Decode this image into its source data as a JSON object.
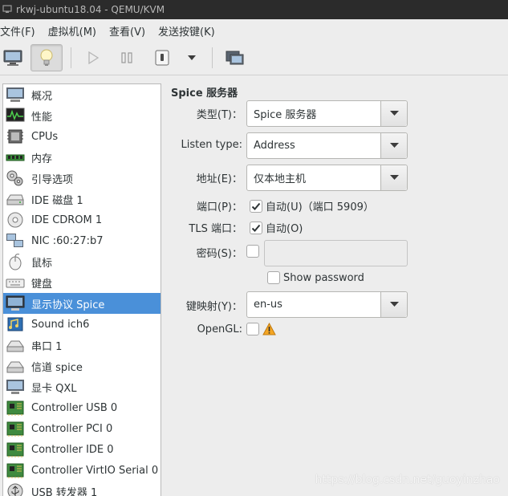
{
  "window": {
    "title": "rkwj-ubuntu18.04 - QEMU/KVM"
  },
  "menubar": {
    "items": [
      {
        "label": "文件(F)"
      },
      {
        "label": "虚拟机(M)"
      },
      {
        "label": "查看(V)"
      },
      {
        "label": "发送按键(K)"
      }
    ]
  },
  "toolbar": {
    "buttons": [
      {
        "icon": "monitor-icon"
      },
      {
        "icon": "lightbulb-icon",
        "active": true
      },
      {
        "icon": "play-icon"
      },
      {
        "icon": "pause-icon"
      },
      {
        "icon": "power-icon"
      },
      {
        "icon": "chevron-down-icon"
      },
      {
        "icon": "fullscreen-icon"
      }
    ]
  },
  "sidebar": {
    "items": [
      {
        "label": "概况",
        "icon": "overview-icon"
      },
      {
        "label": "性能",
        "icon": "performance-icon"
      },
      {
        "label": "CPUs",
        "icon": "cpu-icon"
      },
      {
        "label": "内存",
        "icon": "memory-icon"
      },
      {
        "label": "引导选项",
        "icon": "boot-options-icon"
      },
      {
        "label": "IDE 磁盘 1",
        "icon": "disk-icon"
      },
      {
        "label": "IDE CDROM 1",
        "icon": "cdrom-icon"
      },
      {
        "label": "NIC :60:27:b7",
        "icon": "nic-icon"
      },
      {
        "label": "鼠标",
        "icon": "mouse-icon"
      },
      {
        "label": "键盘",
        "icon": "keyboard-icon"
      },
      {
        "label": "显示协议 Spice",
        "icon": "display-icon",
        "selected": true
      },
      {
        "label": "Sound ich6",
        "icon": "sound-icon"
      },
      {
        "label": "串口 1",
        "icon": "serial-icon"
      },
      {
        "label": "信道 spice",
        "icon": "channel-icon"
      },
      {
        "label": "显卡 QXL",
        "icon": "video-card-icon"
      },
      {
        "label": "Controller USB 0",
        "icon": "controller-icon"
      },
      {
        "label": "Controller PCI 0",
        "icon": "controller-icon"
      },
      {
        "label": "Controller IDE 0",
        "icon": "controller-icon"
      },
      {
        "label": "Controller VirtIO Serial 0",
        "icon": "controller-icon"
      },
      {
        "label": "USB 转发器 1",
        "icon": "usb-redirector-icon"
      }
    ]
  },
  "details": {
    "title": "Spice 服务器",
    "type": {
      "label": "类型(T)：",
      "value": "Spice 服务器"
    },
    "listen_type": {
      "label": "Listen type:",
      "value": "Address"
    },
    "address": {
      "label": "地址(E)：",
      "value": "仅本地主机"
    },
    "port": {
      "label": "端口(P)：",
      "checkbox_label": "自动(U)（端口 5909）",
      "checked": true
    },
    "tls_port": {
      "label": "TLS 端口：",
      "checkbox_label": "自动(O)",
      "checked": true
    },
    "password": {
      "label": "密码(S)：",
      "checked": false,
      "value": ""
    },
    "show_password": {
      "label": "Show password",
      "checked": false
    },
    "keymap": {
      "label": "键映射(Y)：",
      "value": "en-us"
    },
    "opengl": {
      "label": "OpenGL:",
      "checked": false,
      "warning_icon": "warning-icon"
    }
  },
  "watermark": {
    "text": "https://blog.csdn.net/guoyinzhao"
  },
  "colors": {
    "selection": "#4a90d9",
    "warning": "#f5a623",
    "titlebar": "#2b2b2b"
  }
}
